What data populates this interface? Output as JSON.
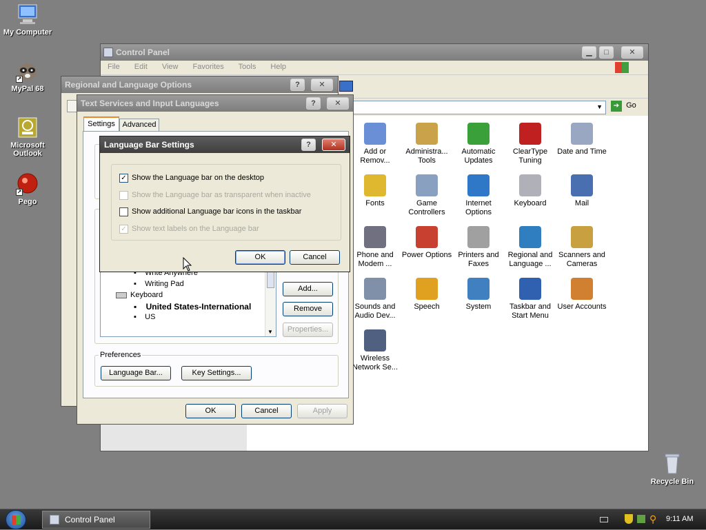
{
  "desktop": {
    "icons": [
      {
        "label": "My Computer"
      },
      {
        "label": "MyPal 68"
      },
      {
        "label": "Microsoft Outlook"
      },
      {
        "label": "Pego"
      },
      {
        "label": "Recycle Bin"
      }
    ]
  },
  "control_panel": {
    "title": "Control Panel",
    "menu": [
      "File",
      "Edit",
      "View",
      "Favorites",
      "Tools",
      "Help"
    ],
    "go_label": "Go",
    "items": [
      {
        "label": "Add or Remov...",
        "color": "#6b8fd6"
      },
      {
        "label": "Administra... Tools",
        "color": "#c9a24a"
      },
      {
        "label": "Automatic Updates",
        "color": "#3aa13a"
      },
      {
        "label": "ClearType Tuning",
        "color": "#c02020"
      },
      {
        "label": "Date and Time",
        "color": "#9aa7c2"
      },
      {
        "label": "Fonts",
        "color": "#e0b830"
      },
      {
        "label": "Game Controllers",
        "color": "#8aa0c0"
      },
      {
        "label": "Internet Options",
        "color": "#2f78c8"
      },
      {
        "label": "Keyboard",
        "color": "#b0b0b8"
      },
      {
        "label": "Mail",
        "color": "#4a6fb0"
      },
      {
        "label": "Phone and Modem ...",
        "color": "#707080"
      },
      {
        "label": "Power Options",
        "color": "#c84030"
      },
      {
        "label": "Printers and Faxes",
        "color": "#a0a0a0"
      },
      {
        "label": "Regional and Language ...",
        "color": "#2f7fc0"
      },
      {
        "label": "Scanners and Cameras",
        "color": "#c8a040"
      },
      {
        "label": "Sounds and Audio Dev...",
        "color": "#8090a8"
      },
      {
        "label": "Speech",
        "color": "#e0a020"
      },
      {
        "label": "System",
        "color": "#4080c0"
      },
      {
        "label": "Taskbar and Start Menu",
        "color": "#3060b0"
      },
      {
        "label": "User Accounts",
        "color": "#d08030"
      },
      {
        "label": "Wireless Network Se...",
        "color": "#506080"
      }
    ]
  },
  "regional": {
    "title": "Regional and Language Options"
  },
  "tsil": {
    "title": "Text Services and Input Languages",
    "tabs": [
      "Settings",
      "Advanced"
    ],
    "list": [
      {
        "text": "Write Anywhere",
        "bold": false
      },
      {
        "text": "Writing Pad",
        "bold": false
      },
      {
        "text": "Keyboard",
        "bold": false
      },
      {
        "text": "United States-International",
        "bold": true
      },
      {
        "text": "US",
        "bold": false
      }
    ],
    "add": "Add...",
    "remove": "Remove",
    "properties": "Properties...",
    "preferences_label": "Preferences",
    "language_bar_btn": "Language Bar...",
    "key_settings_btn": "Key Settings...",
    "ok": "OK",
    "cancel": "Cancel",
    "apply": "Apply"
  },
  "langbar": {
    "title": "Language Bar Settings",
    "options": [
      {
        "label": "Show the Language bar on the desktop",
        "checked": true,
        "enabled": true
      },
      {
        "label": "Show the Language bar as transparent when inactive",
        "checked": false,
        "enabled": false
      },
      {
        "label": "Show additional Language bar icons in the taskbar",
        "checked": false,
        "enabled": true
      },
      {
        "label": "Show text labels on the Language bar",
        "checked": true,
        "enabled": false
      }
    ],
    "ok": "OK",
    "cancel": "Cancel"
  },
  "taskbar": {
    "task_label": "Control Panel",
    "clock": "9:11 AM"
  }
}
